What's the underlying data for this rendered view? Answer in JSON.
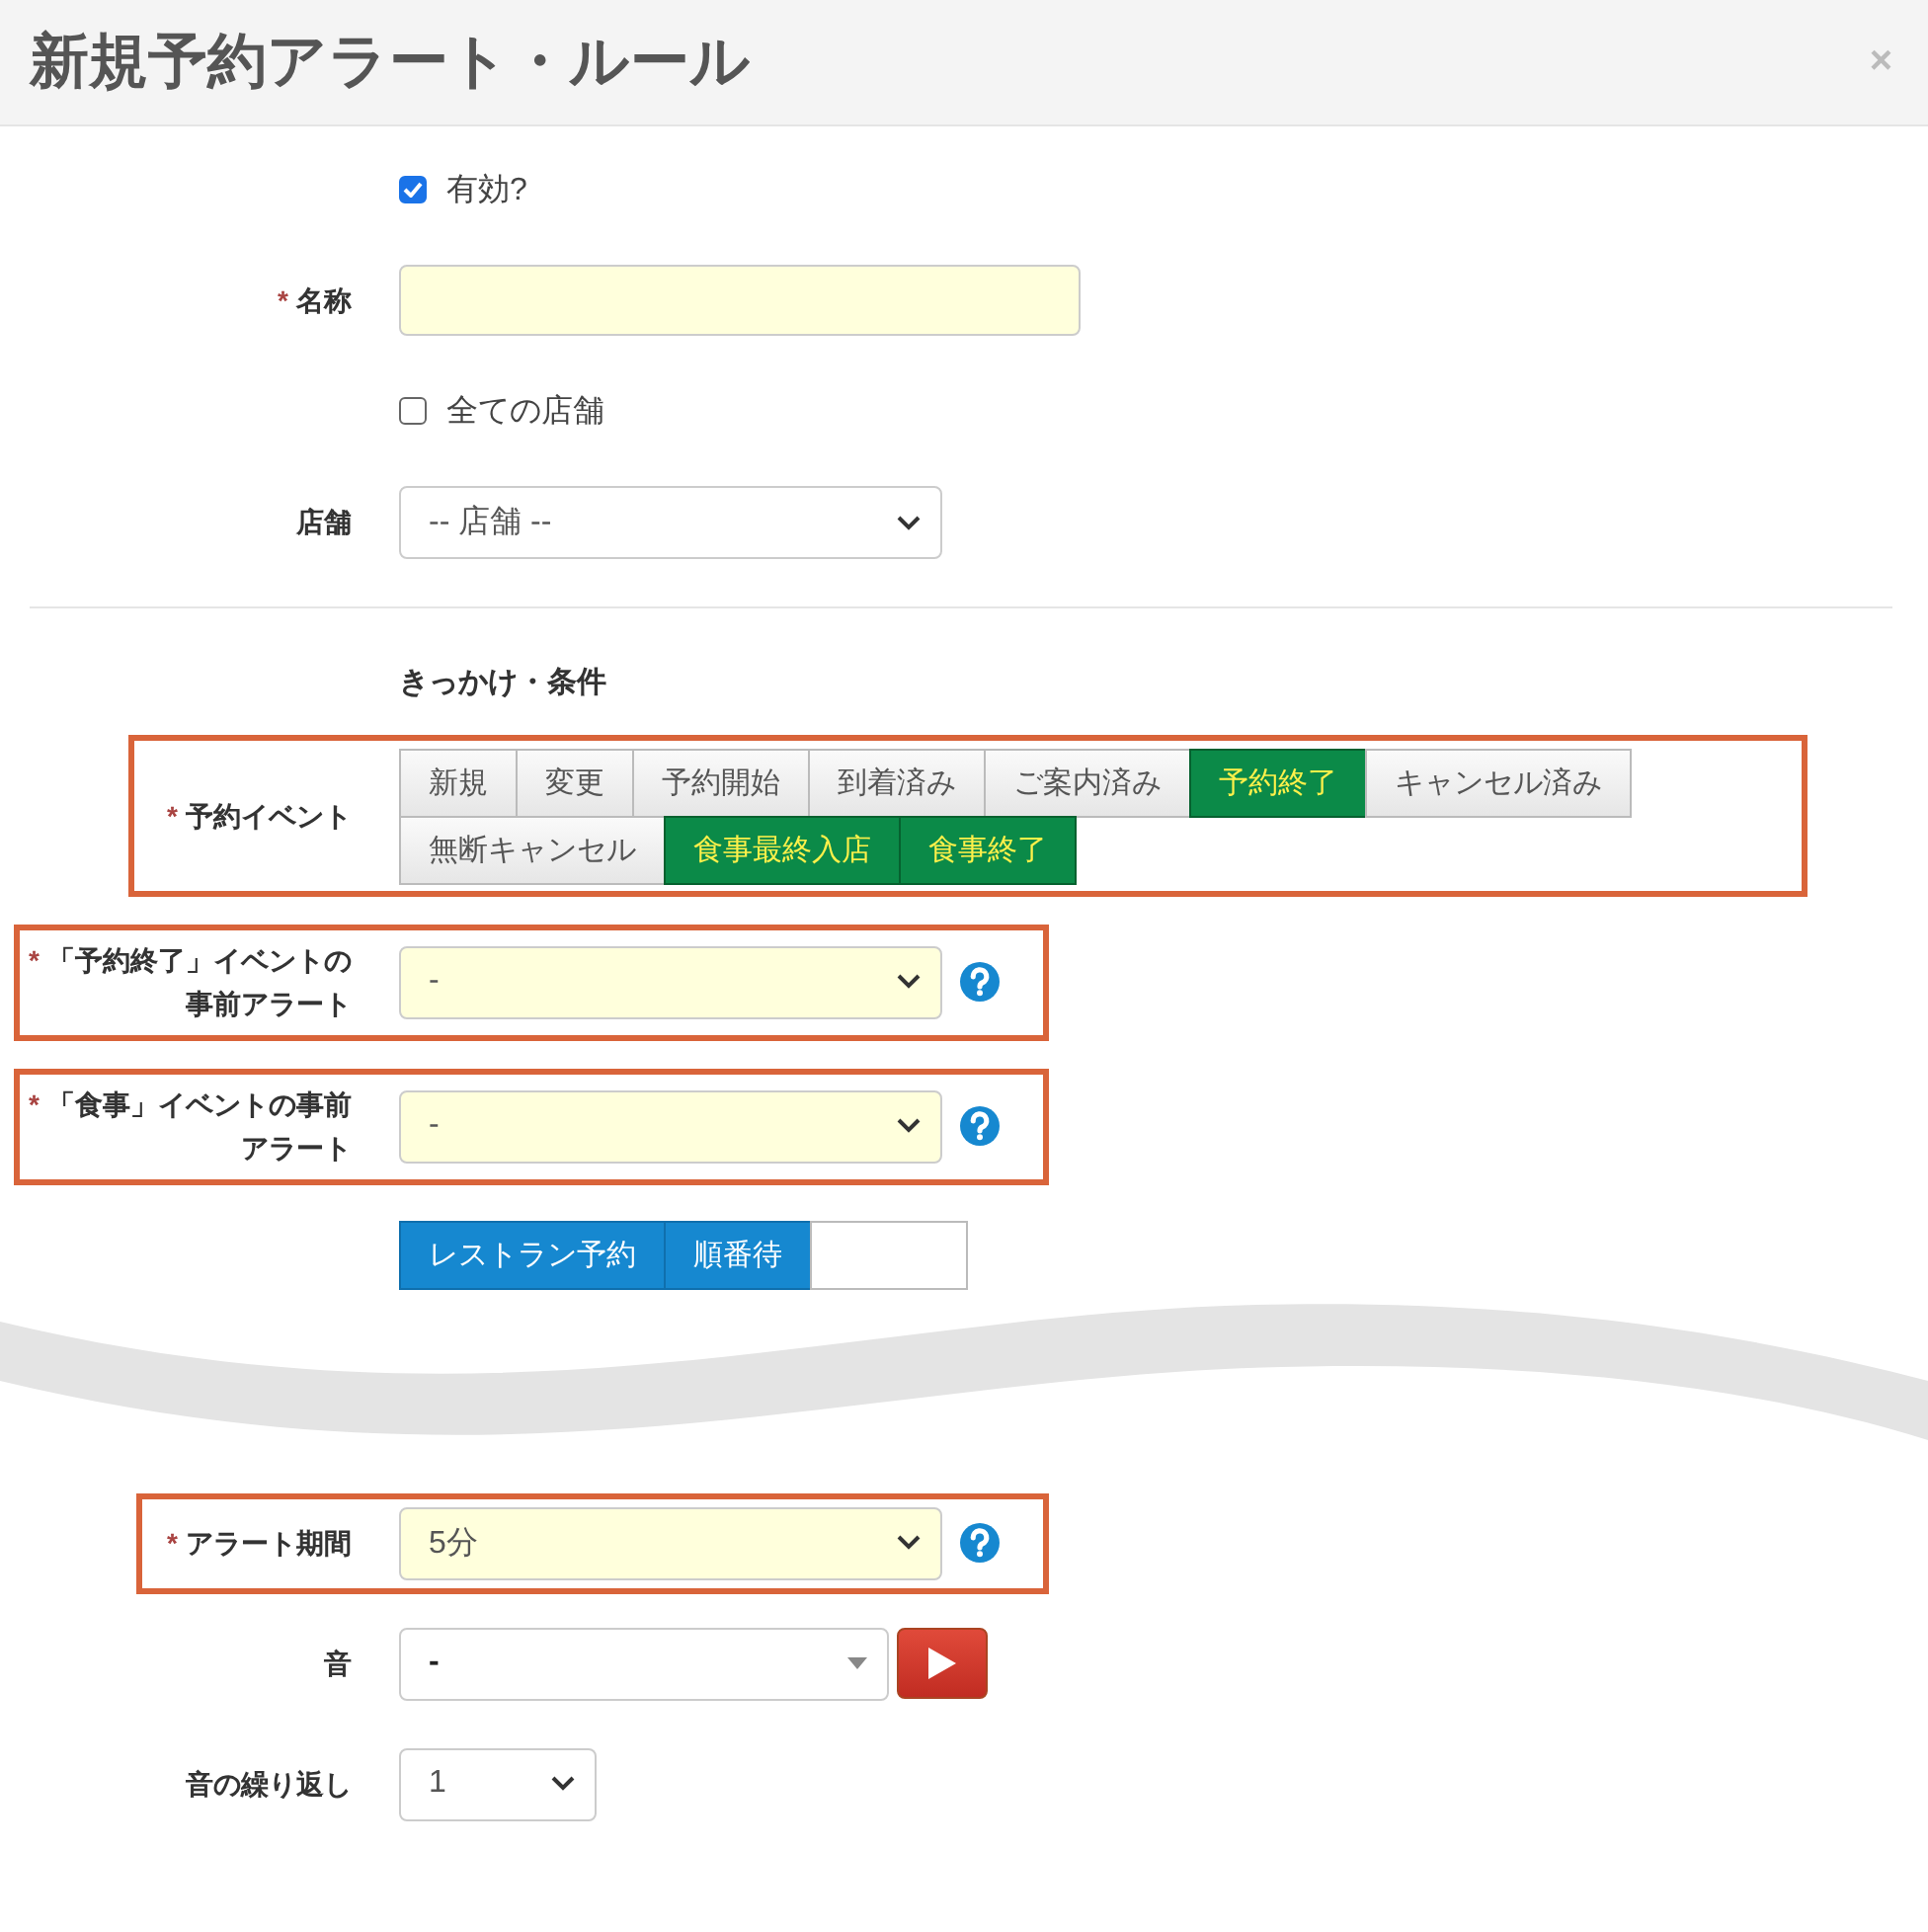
{
  "dialog": {
    "title": "新規予約アラート・ルール",
    "close": "×"
  },
  "fields": [
    {
      "kind": "checkbox",
      "label": "有効?",
      "checked": true
    },
    {
      "kind": "text",
      "label": "名称",
      "required": "*",
      "filled": true
    },
    {
      "kind": "checkbox",
      "label": "全ての店舗",
      "checked": false
    },
    {
      "kind": "select",
      "label": "店舗",
      "value": "-- 店舗 --"
    },
    {
      "kind": "divider"
    },
    {
      "kind": "heading",
      "text": "きっかけ・条件"
    },
    {
      "kind": "toggles",
      "label": "予約イベント",
      "required": "*",
      "highlighted": true,
      "options": [
        {
          "label": "新規",
          "selected": false
        },
        {
          "label": "変更",
          "selected": false
        },
        {
          "label": "予約開始",
          "selected": false
        },
        {
          "label": "到着済み",
          "selected": false
        },
        {
          "label": "ご案内済み",
          "selected": false
        },
        {
          "label": "予約終了",
          "selected": true
        },
        {
          "label": "キャンセル済み",
          "selected": false
        },
        {
          "label": "無断キャンセル",
          "selected": false
        },
        {
          "label": "食事最終入店",
          "selected": true
        },
        {
          "label": "食事終了",
          "selected": true
        }
      ]
    },
    {
      "kind": "select",
      "label": "「予約終了」イベントの事前アラート",
      "required": "*",
      "highlighted": true,
      "filled": true,
      "help": true,
      "value": "-"
    },
    {
      "kind": "select",
      "label": "「食事」イベントの事前アラート",
      "required": "*",
      "highlighted": true,
      "filled": true,
      "help": true,
      "value": "-"
    },
    {
      "kind": "segments",
      "options": [
        {
          "label": "レストラン予約",
          "selected": true
        },
        {
          "label": "順番待",
          "selected": true
        },
        {
          "selected": false
        }
      ]
    },
    {
      "kind": "break"
    },
    {
      "kind": "select",
      "label": "アラート期間",
      "required": "*",
      "highlighted": true,
      "filled": true,
      "help": true,
      "value": "5分"
    },
    {
      "kind": "sound",
      "label": "音",
      "value": "-"
    },
    {
      "kind": "select-small",
      "label": "音の繰り返し",
      "value": "1"
    }
  ]
}
